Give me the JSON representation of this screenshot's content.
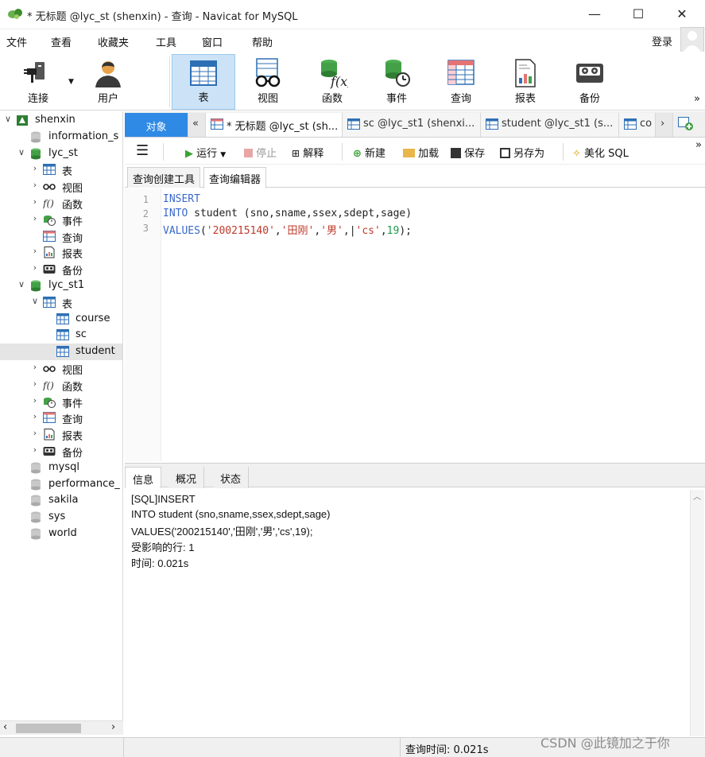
{
  "window": {
    "title": "* 无标题 @lyc_st (shenxin) - 查询 - Navicat for MySQL",
    "minimize": "—",
    "maximize": "☐",
    "close": "✕"
  },
  "menu": {
    "items": [
      "文件",
      "查看",
      "收藏夹",
      "工具",
      "窗口",
      "帮助"
    ],
    "login": "登录"
  },
  "ribbon": {
    "buttons": [
      "连接",
      "用户",
      "表",
      "视图",
      "函数",
      "事件",
      "查询",
      "报表",
      "备份"
    ],
    "active": "表",
    "overflow": "»"
  },
  "sidebar": {
    "rows": [
      {
        "label": "shenxin",
        "arrow": "∨",
        "icon": "connection-icon"
      },
      {
        "label": "information_s",
        "arrow": "",
        "icon": "database-gray-icon"
      },
      {
        "label": "lyc_st",
        "arrow": "∨",
        "icon": "database-green-icon"
      },
      {
        "label": "表",
        "arrow": "›",
        "icon": "table-icon"
      },
      {
        "label": "视图",
        "arrow": "›",
        "icon": "view-icon"
      },
      {
        "label": "函数",
        "arrow": "›",
        "icon": "function-icon"
      },
      {
        "label": "事件",
        "arrow": "›",
        "icon": "event-icon"
      },
      {
        "label": "查询",
        "arrow": "",
        "icon": "query-icon"
      },
      {
        "label": "报表",
        "arrow": "›",
        "icon": "report-icon"
      },
      {
        "label": "备份",
        "arrow": "›",
        "icon": "backup-icon"
      },
      {
        "label": "lyc_st1",
        "arrow": "∨",
        "icon": "database-green-icon"
      },
      {
        "label": "表",
        "arrow": "∨",
        "icon": "table-icon"
      },
      {
        "label": "course",
        "arrow": "",
        "icon": "table-icon"
      },
      {
        "label": "sc",
        "arrow": "",
        "icon": "table-icon"
      },
      {
        "label": "student",
        "arrow": "",
        "icon": "table-icon"
      },
      {
        "label": "视图",
        "arrow": "›",
        "icon": "view-icon"
      },
      {
        "label": "函数",
        "arrow": "›",
        "icon": "function-icon"
      },
      {
        "label": "事件",
        "arrow": "›",
        "icon": "event-icon"
      },
      {
        "label": "查询",
        "arrow": "›",
        "icon": "query-icon"
      },
      {
        "label": "报表",
        "arrow": "›",
        "icon": "report-icon"
      },
      {
        "label": "备份",
        "arrow": "›",
        "icon": "backup-icon"
      },
      {
        "label": "mysql",
        "arrow": "",
        "icon": "database-gray-icon"
      },
      {
        "label": "performance_",
        "arrow": "",
        "icon": "database-gray-icon"
      },
      {
        "label": "sakila",
        "arrow": "",
        "icon": "database-gray-icon"
      },
      {
        "label": "sys",
        "arrow": "",
        "icon": "database-gray-icon"
      },
      {
        "label": "world",
        "arrow": "",
        "icon": "database-gray-icon"
      }
    ],
    "selected_label": "student",
    "scroll_left": "‹",
    "scroll_right": "›"
  },
  "tabs": {
    "objects": "对象",
    "back": "«",
    "items": [
      "* 无标题 @lyc_st (sh...",
      "sc @lyc_st1 (shenxi...",
      "student @lyc_st1 (s...",
      "co"
    ],
    "next": "›"
  },
  "query_toolbar": {
    "run": "运行",
    "stop": "停止",
    "explain": "解释",
    "new": "新建",
    "load": "加载",
    "save": "保存",
    "save_as": "另存为",
    "beautify": "美化 SQL",
    "overflow": "»"
  },
  "sub_tabs": [
    "查询创建工具",
    "查询编辑器"
  ],
  "editor": {
    "line_numbers": [
      "1",
      "2",
      "3"
    ],
    "line1_kw": "INSERT",
    "line2_kw": "INTO",
    "line2_rest": " student (sno,sname,ssex,sdept,sage)",
    "line3_kw": "VALUES",
    "line3_open": "(",
    "line3_s1": "'200215140'",
    "line3_c1": ",",
    "line3_s2": "'田刚'",
    "line3_c2": ",",
    "line3_s3": "'男'",
    "line3_c3": ",",
    "line3_caret": "|",
    "line3_s4": "'cs'",
    "line3_c4": ",",
    "line3_num": "19",
    "line3_close": ");"
  },
  "result": {
    "tabs": [
      "信息",
      "概况",
      "状态"
    ],
    "lines": [
      "[SQL]INSERT",
      "INTO student (sno,sname,ssex,sdept,sage)",
      "VALUES('200215140','田刚','男','cs',19);",
      "受影响的行: 1",
      "时间: 0.021s"
    ]
  },
  "status": {
    "query_time": "查询时间: 0.021s"
  },
  "watermark": "CSDN @此镜加之于你"
}
